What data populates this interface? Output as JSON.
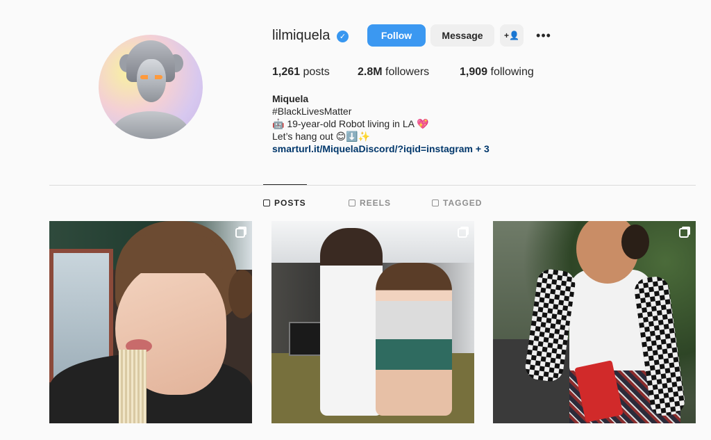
{
  "profile": {
    "username": "lilmiquela",
    "verified_glyph": "✓",
    "follow_label": "Follow",
    "message_label": "Message",
    "add_user_label": "+👤",
    "more_label": "•••"
  },
  "stats": {
    "posts_count": "1,261",
    "posts_label": "posts",
    "followers_count": "2.8M",
    "followers_label": "followers",
    "following_count": "1,909",
    "following_label": "following"
  },
  "bio": {
    "name": "Miquela",
    "line1": "#BlackLivesMatter",
    "line2": "🤖 19-year-old Robot living in LA 💖",
    "line3": "Let’s hang out 😊⬇️✨",
    "link": "smarturl.it/MiquelaDiscord/?iqid=instagram + 3"
  },
  "tabs": [
    {
      "label": "POSTS",
      "icon": "grid-icon",
      "active": true
    },
    {
      "label": "REELS",
      "icon": "reels-icon",
      "active": false
    },
    {
      "label": "TAGGED",
      "icon": "tagged-icon",
      "active": false
    }
  ],
  "colors": {
    "accent": "#3b98f1",
    "link": "#00376b",
    "background": "#fafafa"
  }
}
